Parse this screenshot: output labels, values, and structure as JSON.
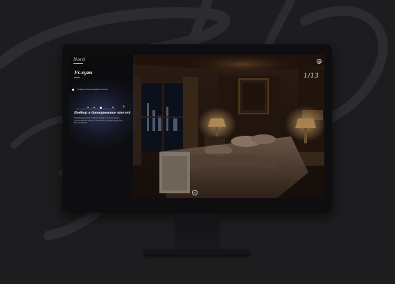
{
  "site": {
    "logo_text": "Nord"
  },
  "panel": {
    "title": "Услуги",
    "menu": [
      {
        "label": "Подбор и бронирование отелей",
        "active": true
      },
      {
        "label": "Организация мероприятий и деловых встреч",
        "active": false
      }
    ],
    "pager": {
      "count": 4,
      "active_index": 2,
      "arrow": "›"
    },
    "section_title": "Подбор и бронирование отелей",
    "section_description": "Индивидуальный подбор отелей по всему миру с учетом ваших личных пожеланий. Гарантированное бронирование."
  },
  "slider": {
    "counter": "1/13"
  },
  "icons": {
    "menu": "menu-circle-icon",
    "scroll": "chevron-down-circle-icon"
  },
  "colors": {
    "accent": "#d8332f",
    "background": "#1d1d1f",
    "glow": "#5f78c8"
  }
}
